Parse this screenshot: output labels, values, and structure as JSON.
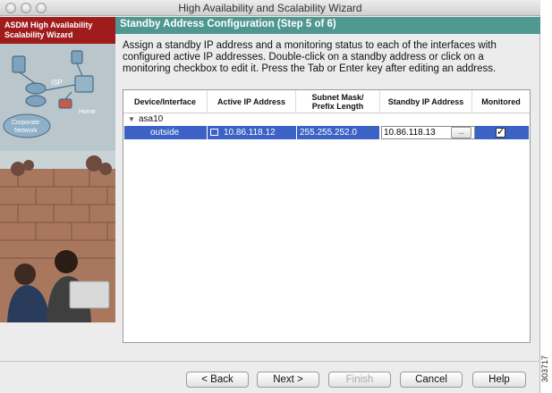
{
  "window": {
    "title": "High Availability and Scalability Wizard"
  },
  "sidebar": {
    "heading_line1": "ASDM High Availability",
    "heading_line2": "Scalability Wizard",
    "art_labels": {
      "isp": "ISP",
      "home": "Home",
      "corporate1": "Corporate",
      "corporate2": "Network"
    }
  },
  "panel": {
    "title": "Standby Address Configuration (Step 5 of 6)",
    "instructions": "Assign a standby IP address and a monitoring status to each of the interfaces with configured active IP addresses. Double-click on a standby address or click on a monitoring checkbox to edit it. Press the Tab or Enter key after editing an address."
  },
  "table": {
    "columns": {
      "device_interface": "Device/Interface",
      "active_ip": "Active IP Address",
      "subnet_line1": "Subnet Mask/",
      "subnet_line2": "Prefix Length",
      "standby_ip": "Standby IP Address",
      "monitored": "Monitored"
    },
    "group": {
      "name": "asa10",
      "expanded": true
    },
    "rows": [
      {
        "interface": "outside",
        "active_ip": "10.86.118.12",
        "subnet": "255.255.252.0",
        "standby_ip": "10.86.118.13",
        "edit_button": "...",
        "monitored": true,
        "selected": true
      }
    ]
  },
  "buttons": {
    "back": "< Back",
    "next": "Next >",
    "finish": "Finish",
    "cancel": "Cancel",
    "help": "Help"
  },
  "figure_id": "303717",
  "colors": {
    "sidebar_header": "#a01c1c",
    "panel_header": "#4f9791",
    "selection": "#3c62c5"
  }
}
